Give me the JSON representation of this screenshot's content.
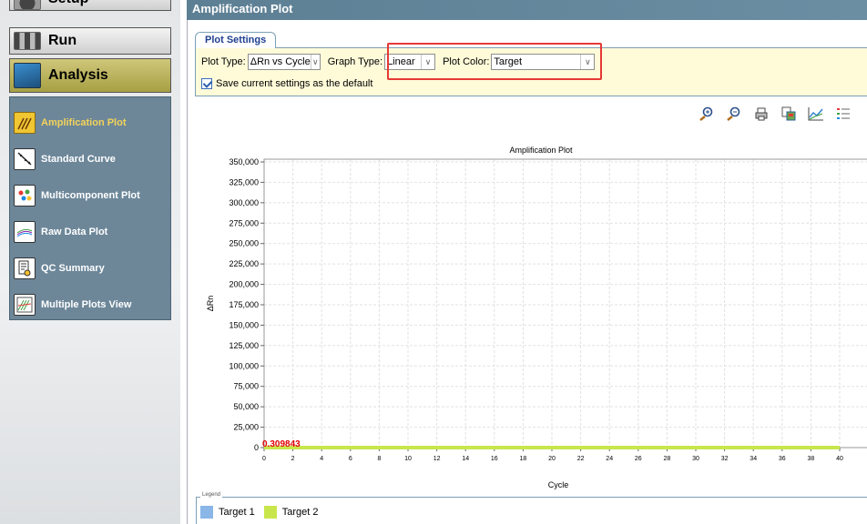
{
  "nav": {
    "setup": "Setup",
    "run": "Run",
    "analysis": "Analysis"
  },
  "subnav": [
    {
      "label": "Amplification Plot",
      "icon": "amplification-icon",
      "active": true
    },
    {
      "label": "Standard Curve",
      "icon": "standard-curve-icon",
      "active": false
    },
    {
      "label": "Multicomponent Plot",
      "icon": "multicomponent-icon",
      "active": false
    },
    {
      "label": "Raw Data Plot",
      "icon": "raw-data-icon",
      "active": false
    },
    {
      "label": "QC Summary",
      "icon": "qc-summary-icon",
      "active": false
    },
    {
      "label": "Multiple Plots View",
      "icon": "multiple-plots-icon",
      "active": false
    }
  ],
  "header": {
    "title": "Amplification Plot"
  },
  "settings": {
    "tab": "Plot Settings",
    "plot_type_label": "Plot Type:",
    "plot_type_value": "ΔRn vs Cycle",
    "graph_type_label": "Graph Type:",
    "graph_type_value": "Linear",
    "plot_color_label": "Plot Color:",
    "plot_color_value": "Target",
    "save_default_label": "Save current settings as the default",
    "save_default_checked": true
  },
  "toolbar": [
    "zoom-in-icon",
    "zoom-out-icon",
    "print-icon",
    "save-image-icon",
    "line-chart-icon",
    "list-icon"
  ],
  "chart_data": {
    "type": "line",
    "title": "Amplification Plot",
    "xlabel": "Cycle",
    "ylabel": "ΔRn",
    "ylim": [
      0,
      350000
    ],
    "yticks": [
      "0",
      "25,000",
      "50,000",
      "75,000",
      "100,000",
      "125,000",
      "150,000",
      "175,000",
      "200,000",
      "225,000",
      "250,000",
      "275,000",
      "300,000",
      "325,000",
      "350,000"
    ],
    "xlim": [
      0,
      40
    ],
    "xticks": [
      "0",
      "2",
      "4",
      "6",
      "8",
      "10",
      "12",
      "14",
      "16",
      "18",
      "20",
      "22",
      "24",
      "26",
      "28",
      "30",
      "32",
      "34",
      "36",
      "38",
      "40"
    ],
    "annotation": "0.309843",
    "grid": true,
    "series": [
      {
        "name": "Target 1",
        "color": "#8ab6e8",
        "x": [
          0,
          40
        ],
        "y": [
          0,
          0
        ]
      },
      {
        "name": "Target 2",
        "color": "#c8e64b",
        "x": [
          0,
          40
        ],
        "y": [
          0,
          0
        ]
      }
    ]
  },
  "legend": {
    "title": "Legend",
    "items": [
      {
        "label": "Target 1",
        "color": "#8ab6e8"
      },
      {
        "label": "Target 2",
        "color": "#c8e64b"
      }
    ]
  }
}
